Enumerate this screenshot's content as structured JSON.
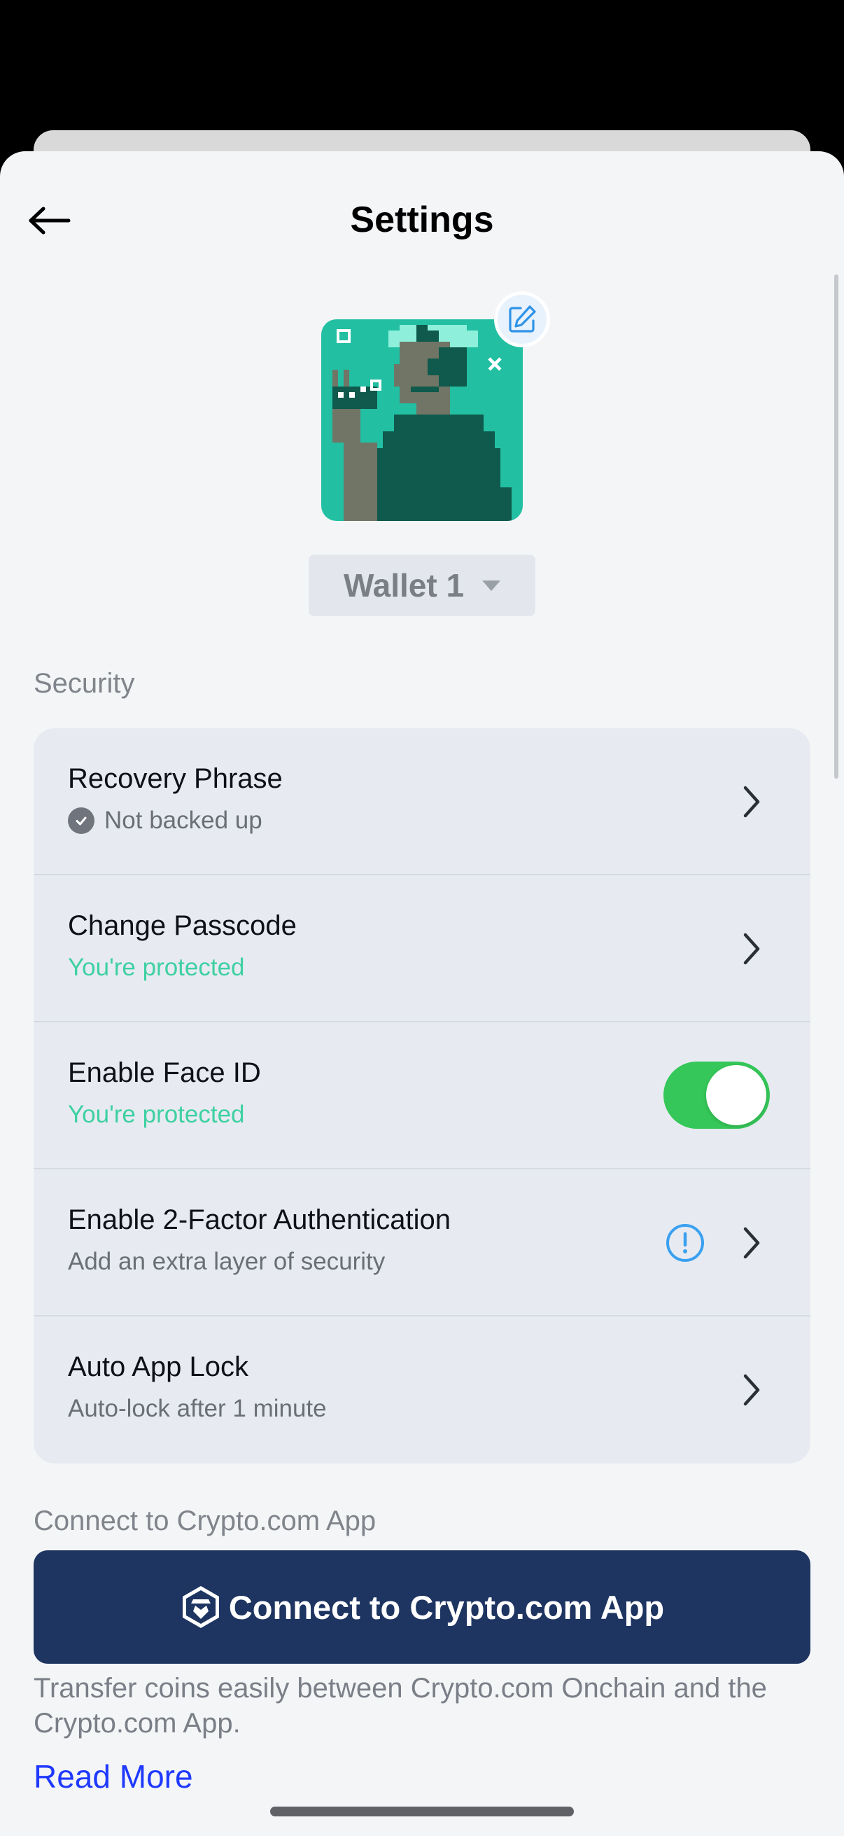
{
  "header": {
    "title": "Settings"
  },
  "wallet": {
    "name": "Wallet 1"
  },
  "security": {
    "section_label": "Security",
    "items": [
      {
        "title": "Recovery Phrase",
        "subtitle": "Not backed up",
        "status": "warning"
      },
      {
        "title": "Change Passcode",
        "subtitle": "You're protected",
        "status": "ok"
      },
      {
        "title": "Enable Face ID",
        "subtitle": "You're protected",
        "status": "ok",
        "toggle_on": true
      },
      {
        "title": "Enable 2-Factor Authentication",
        "subtitle": "Add an extra layer of security"
      },
      {
        "title": "Auto App Lock",
        "subtitle": "Auto-lock after 1 minute"
      }
    ]
  },
  "connect": {
    "section_label": "Connect to Crypto.com App",
    "button_label": "Connect to Crypto.com App",
    "description": "Transfer coins easily between Crypto.com Onchain and the Crypto.com App.",
    "read_more": "Read More"
  },
  "colors": {
    "accent_green": "#35c759",
    "protected_text": "#3fd0a2",
    "connect_button": "#1e3461",
    "link": "#1f39ff",
    "info_blue": "#3aa0f0"
  },
  "icons": {
    "back": "arrow-left-icon",
    "edit": "edit-pencil-icon",
    "chevron": "chevron-right-icon",
    "warning": "exclamation-circle-icon",
    "check": "check-circle-icon",
    "crypto_logo": "crypto-com-logo-icon"
  }
}
